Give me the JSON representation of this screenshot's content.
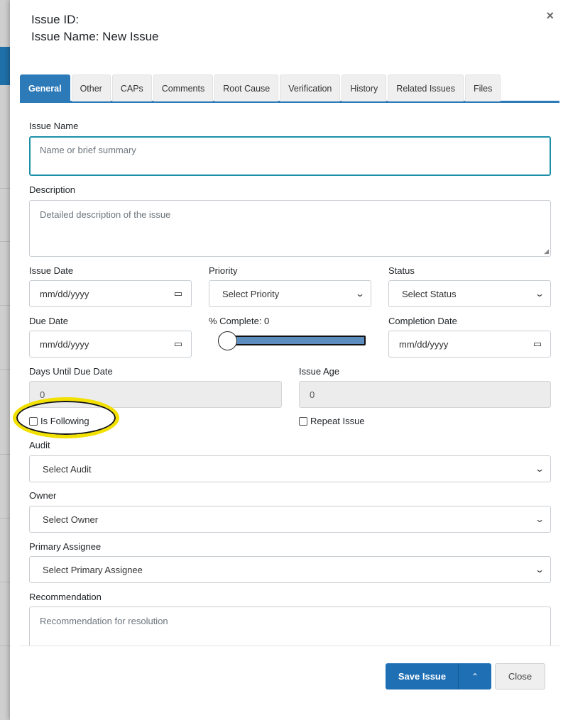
{
  "header": {
    "issue_id_label": "Issue ID:",
    "issue_name_label": "Issue Name: New Issue",
    "close_icon": "×"
  },
  "tabs": [
    {
      "label": "General",
      "active": true
    },
    {
      "label": "Other"
    },
    {
      "label": "CAPs"
    },
    {
      "label": "Comments"
    },
    {
      "label": "Root Cause"
    },
    {
      "label": "Verification"
    },
    {
      "label": "History"
    },
    {
      "label": "Related Issues"
    },
    {
      "label": "Files"
    }
  ],
  "form": {
    "issue_name": {
      "label": "Issue Name",
      "placeholder": "Name or brief summary"
    },
    "description": {
      "label": "Description",
      "placeholder": "Detailed description of the issue"
    },
    "issue_date": {
      "label": "Issue Date",
      "value": "mm/dd/yyyy"
    },
    "priority": {
      "label": "Priority",
      "value": "Select Priority"
    },
    "status": {
      "label": "Status",
      "value": "Select Status"
    },
    "due_date": {
      "label": "Due Date",
      "value": "mm/dd/yyyy"
    },
    "percent_complete": {
      "label": "% Complete: 0",
      "value": 0
    },
    "completion_date": {
      "label": "Completion Date",
      "value": "mm/dd/yyyy"
    },
    "days_until_due": {
      "label": "Days Until Due Date",
      "value": "0"
    },
    "issue_age": {
      "label": "Issue Age",
      "value": "0"
    },
    "is_following": {
      "label": "Is Following",
      "checked": false
    },
    "repeat_issue": {
      "label": "Repeat Issue",
      "checked": false
    },
    "audit": {
      "label": "Audit",
      "value": "Select Audit"
    },
    "owner": {
      "label": "Owner",
      "value": "Select Owner"
    },
    "primary_assignee": {
      "label": "Primary Assignee",
      "value": "Select Primary Assignee"
    },
    "recommendation": {
      "label": "Recommendation",
      "placeholder": "Recommendation for resolution"
    }
  },
  "footer": {
    "save_label": "Save Issue",
    "caret_icon": "⌃",
    "close_label": "Close"
  },
  "colors": {
    "accent": "#2d7ab8",
    "primary_button": "#1f6fb5",
    "highlight": "#f2e000",
    "focus_border": "#1b8fa8"
  }
}
